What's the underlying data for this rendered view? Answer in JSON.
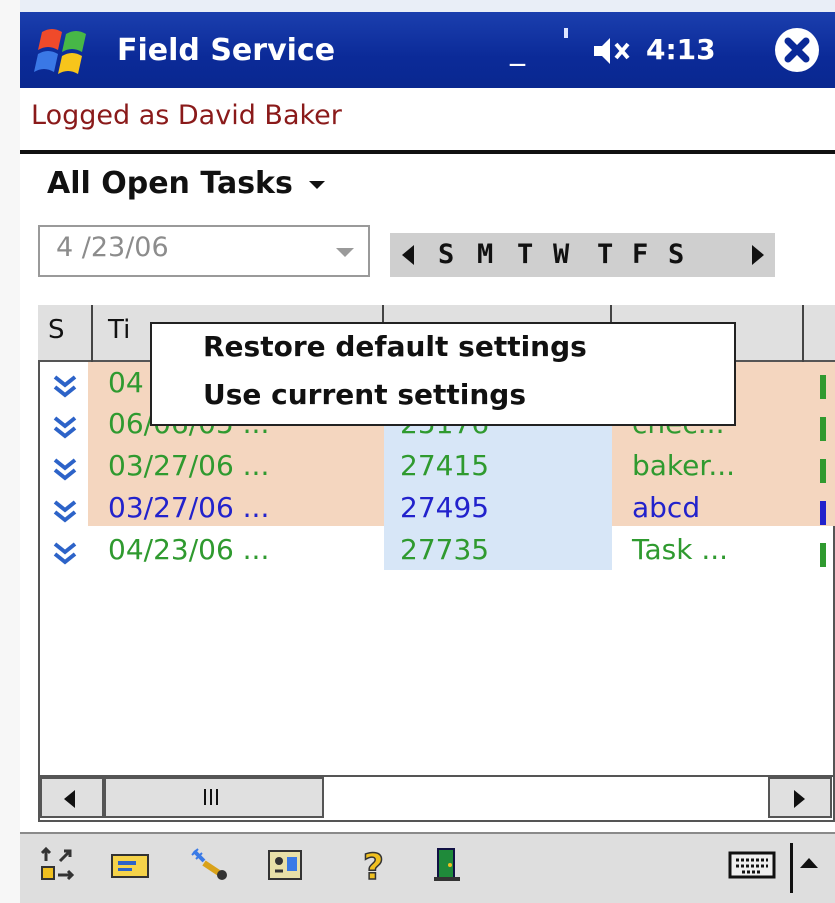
{
  "titlebar": {
    "app_title": "Field Service",
    "clock": "4:13",
    "start_icon": "windows-flag-icon",
    "volume_icon": "speaker-muted-icon",
    "close_icon": "close-icon"
  },
  "user": {
    "logged_as": "Logged as David Baker"
  },
  "filter": {
    "label": "All Open Tasks",
    "dropdown_icon": "chevron-down-icon"
  },
  "date_picker": {
    "value": "4 /23/06"
  },
  "week_nav": {
    "days": [
      "S",
      "M",
      "T",
      "W",
      "T",
      "F",
      "S"
    ]
  },
  "grid": {
    "headers": [
      "S",
      "Ti"
    ],
    "rows": [
      {
        "time": "04",
        "id": "",
        "desc": "...",
        "color": "#2f9a2f",
        "bg": "#f4d6bf"
      },
      {
        "time": "06/06/05 ...",
        "id": "25176",
        "desc": "chec...",
        "color": "#2f9a2f",
        "bg": "#f4d6bf"
      },
      {
        "time": "03/27/06 ...",
        "id": "27415",
        "desc": "baker...",
        "color": "#2f9a2f",
        "bg": "#f4d6bf"
      },
      {
        "time": "03/27/06 ...",
        "id": "27495",
        "desc": "abcd",
        "color": "#2222cc",
        "bg": "#f4d6bf"
      },
      {
        "time": "04/23/06 ...",
        "id": "27735",
        "desc": "Task ...",
        "color": "#2f9a2f",
        "bg": "#ffffff"
      }
    ]
  },
  "context_menu": {
    "items": [
      "Restore default settings",
      "Use current settings"
    ]
  },
  "colors": {
    "titlebar": "#0b2a98",
    "logged_text": "#8a1a1a",
    "row_highlight": "#f4d6bf",
    "id_column": "#d7e6f7"
  },
  "toolbar": {
    "icons": [
      "sync-icon",
      "envelope-icon",
      "wrench-icon",
      "contacts-icon",
      "help-icon",
      "exit-door-icon",
      "keyboard-icon"
    ]
  }
}
